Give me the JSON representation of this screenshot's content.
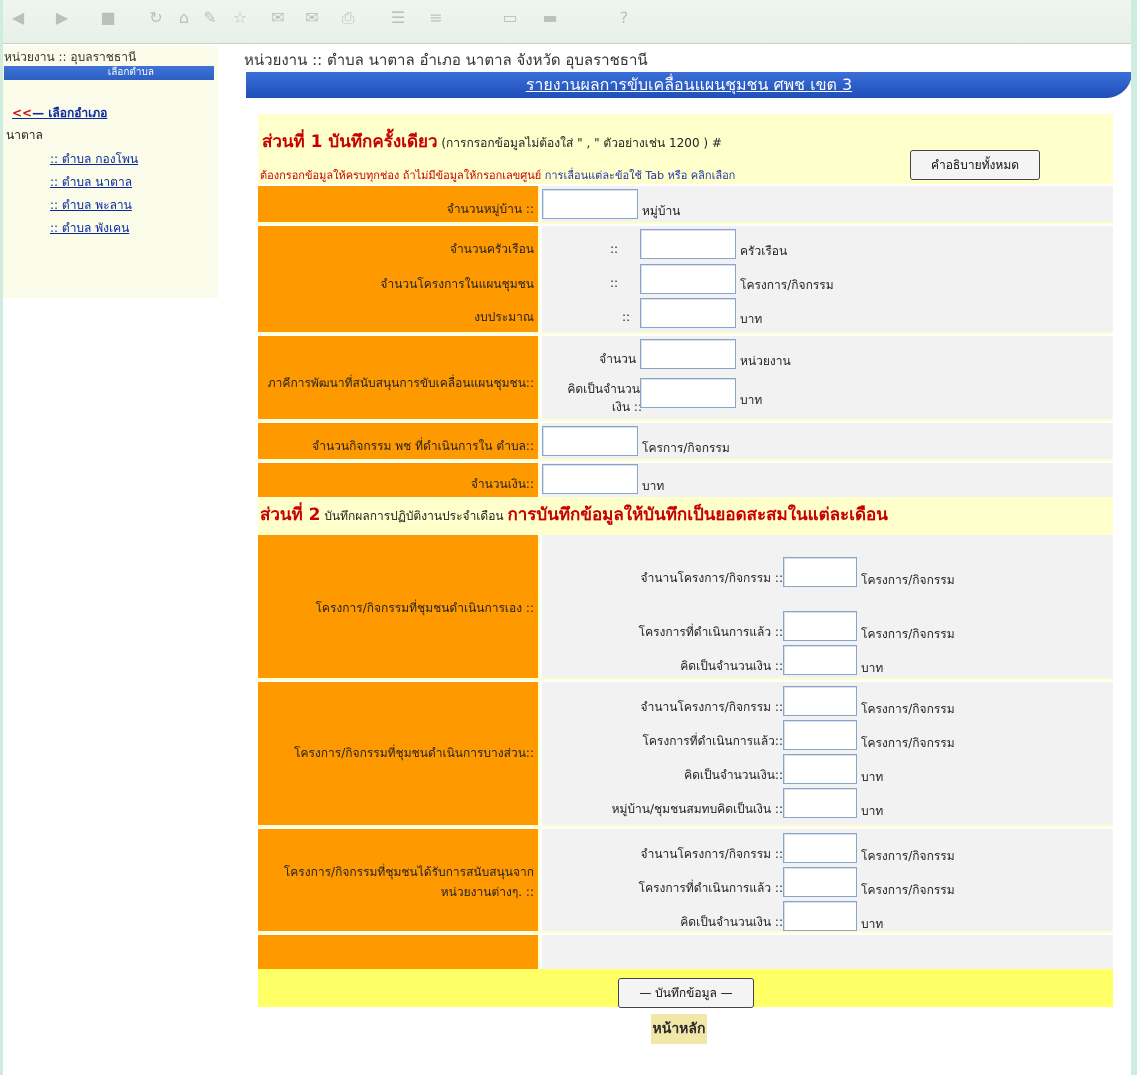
{
  "toolbar": {
    "icons": [
      "back-icon",
      "forward-icon",
      "stop-icon",
      "refresh-icon",
      "home-icon",
      "edit-icon",
      "star-icon",
      "history-icon",
      "mail-icon",
      "print-icon",
      "discuss-icon",
      "folder-icon",
      "media-icon",
      "settings-icon",
      "help-icon"
    ]
  },
  "sidebar": {
    "unit_label": "หน่วยงาน :: อุบลราชธานี",
    "bar_label": "เลือกตำบล",
    "back_arrow": "<<",
    "back_label": "— เลือกอำเภอ",
    "district": "นาตาล",
    "links": [
      ":: ตำบล กองโพน",
      ":: ตำบล นาตาล",
      ":: ตำบล พะลาน",
      ":: ตำบล พังเคน"
    ]
  },
  "header": {
    "unit_title": "หน่วยงาน :: ตำบล นาตาล อำเภอ นาตาล จังหวัด อุบลราชธานี",
    "banner": "รายงานผลการขับเคลื่อนแผนชุมชน ศพช เขต 3"
  },
  "section1": {
    "title": "ส่วนที่ 1 บันทึกครั้งเดียว",
    "note": " (การกรอกข้อมูลไม่ต้องใส่ \" , \" ตัวอย่างเช่น 1200 )  #",
    "warn_red": "ต้องกรอกข้อมูลให้ครบทุกช่อง ถ้าไม่มีข้อมูลให้กรอกเลขศูนย์",
    "warn_blue": " การเลื่อนแต่ละข้อใช้ Tab หรือ คลิกเลือก",
    "explain_button": "คำอธิบายทั้งหมด",
    "villages_label": "จำนวนหมู่บ้าน ::",
    "villages_unit": "หมู่บ้าน",
    "households_label": "จำนวนครัวเรือน",
    "households_prefix": "::",
    "households_unit": "ครัวเรือน",
    "projects_label": "จำนวนโครงการในแผนชุมชน",
    "projects_prefix": "::",
    "projects_unit": "โครงการ/กิจกรรม",
    "budget_label": "งบประมาณ",
    "budget_prefix": "::",
    "budget_unit": "บาท",
    "partners_label": "ภาคีการพัฒนาที่สนับสนุนการขับเคลื่อนแผนชุมชน::",
    "partners_count_label": "จำนวน ::",
    "partners_count_unit": "หน่วยงาน",
    "partners_money_label_1": "คิดเป็นจำนวน",
    "partners_money_label_2": "เงิน ::",
    "partners_money_unit": "บาท",
    "activities_label": "จำนวนกิจกรรม พช ที่ดำเนินการใน ตำบล::",
    "activities_unit": "โครการ/กิจกรรม",
    "money_label": "จำนวนเงิน::",
    "money_unit": "บาท"
  },
  "section2": {
    "title": "ส่วนที่ 2",
    "subtitle": " บันทึกผลการปฏิบัติงานประจำเดือน ",
    "highlight": "การบันทึกข้อมูลให้บันทึกเป็นยอดสะสมในแต่ละเดือน",
    "group1": {
      "label": "โครงการ/กิจกรรมที่ชุมชนดำเนินการเอง ::",
      "rows": [
        {
          "label": "จำนานโครงการ/กิจกรรม ::",
          "unit": "โครงการ/กิจกรรม"
        },
        {
          "label": "โครงการที่ดำเนินการแล้ว ::",
          "unit": "โครงการ/กิจกรรม"
        },
        {
          "label": "คิดเป็นจำนวนเงิน ::",
          "unit": "บาท"
        }
      ]
    },
    "group2": {
      "label": "โครงการ/กิจกรรมที่ชุมชนดำเนินการบางส่วน::",
      "rows": [
        {
          "label": "จำนานโครงการ/กิจกรรม ::",
          "unit": "โครงการ/กิจกรรม"
        },
        {
          "label": "โครงการที่ดำเนินการแล้ว::",
          "unit": "โครงการ/กิจกรรม"
        },
        {
          "label": "คิดเป็นจำนวนเงิน::",
          "unit": "บาท"
        },
        {
          "label": "หมู่บ้าน/ชุมชนสมทบคิดเป็นเงิน ::",
          "unit": "บาท"
        }
      ]
    },
    "group3": {
      "label_1": "โครงการ/กิจกรรมที่ชุมชนได้รับการสนับสนุนจาก",
      "label_2": "หน่วยงานต่างๆ. ::",
      "rows": [
        {
          "label": "จำนานโครงการ/กิจกรรม ::",
          "unit": "โครงการ/กิจกรรม"
        },
        {
          "label": "โครงการที่ดำเนินการแล้ว ::",
          "unit": "โครงการ/กิจกรรม"
        },
        {
          "label": "คิดเป็นจำนวนเงิน ::",
          "unit": "บาท"
        }
      ]
    }
  },
  "actions": {
    "save_button": "— บันทึกข้อมูล —",
    "home_button": "หน้าหลัก"
  }
}
